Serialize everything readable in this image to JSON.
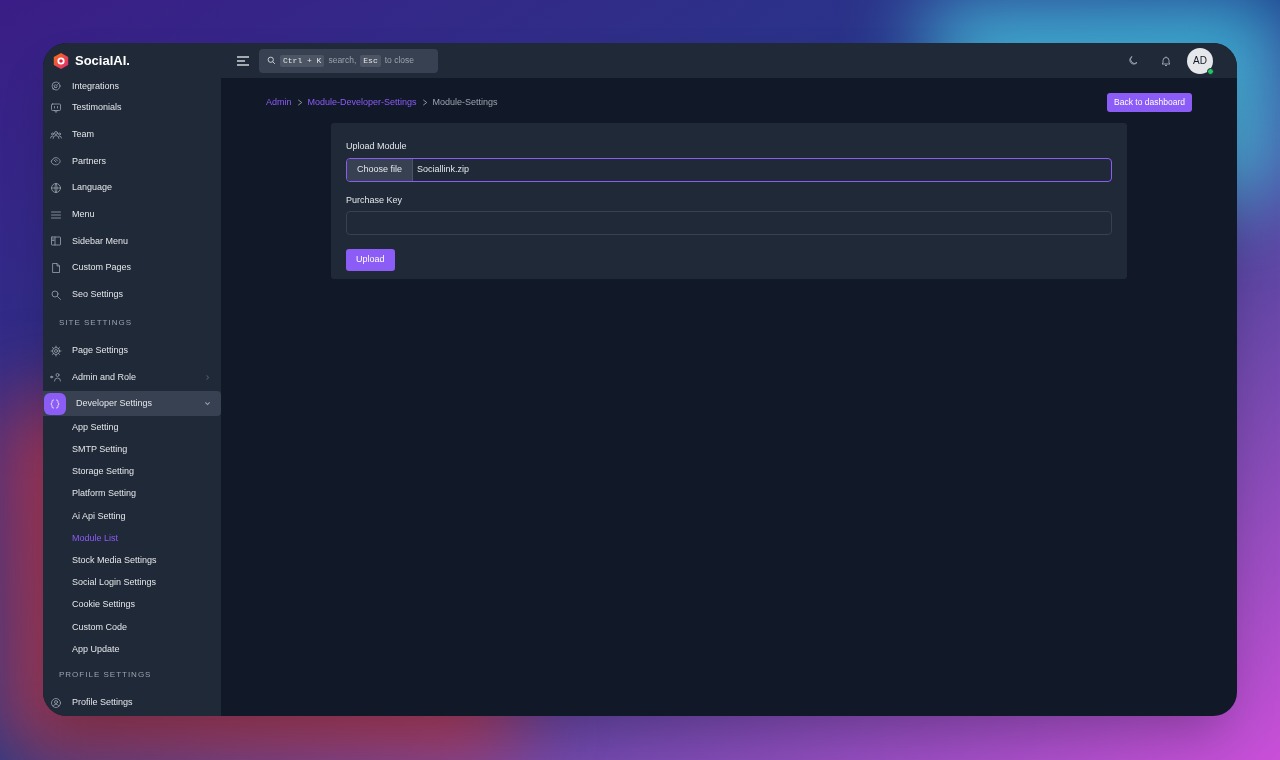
{
  "app": {
    "name": "SocialAI."
  },
  "search": {
    "shortcut_key": "Ctrl + K",
    "shortcut_text": "search,",
    "close_key": "Esc",
    "close_text": "to close"
  },
  "user": {
    "initials": "AD",
    "online": true
  },
  "sidebar": {
    "items": [
      {
        "kind": "link",
        "label": "Integrations",
        "selected": false
      },
      {
        "kind": "link",
        "label": "Testimonials",
        "selected": false
      },
      {
        "kind": "link",
        "label": "Team",
        "selected": false
      },
      {
        "kind": "link",
        "label": "Partners",
        "selected": false
      },
      {
        "kind": "link",
        "label": "Language",
        "selected": false
      },
      {
        "kind": "link",
        "label": "Menu",
        "selected": false
      },
      {
        "kind": "link",
        "label": "Sidebar Menu",
        "selected": false
      },
      {
        "kind": "link",
        "label": "Custom Pages",
        "selected": false
      },
      {
        "kind": "link",
        "label": "Seo Settings",
        "selected": false
      },
      {
        "kind": "heading",
        "label": "SITE SETTINGS"
      },
      {
        "kind": "link",
        "label": "Page Settings",
        "selected": false
      },
      {
        "kind": "group",
        "label": "Admin and Role",
        "selected": false,
        "expanded": false
      },
      {
        "kind": "group",
        "label": "Developer Settings",
        "selected": true,
        "expanded": true,
        "children": [
          {
            "label": "App Setting",
            "selected": false
          },
          {
            "label": "SMTP Setting",
            "selected": false
          },
          {
            "label": "Storage Setting",
            "selected": false
          },
          {
            "label": "Platform Setting",
            "selected": false
          },
          {
            "label": "Ai Api Setting",
            "selected": false
          },
          {
            "label": "Module List",
            "selected": true
          },
          {
            "label": "Stock Media Settings",
            "selected": false
          },
          {
            "label": "Social Login Settings",
            "selected": false
          },
          {
            "label": "Cookie Settings",
            "selected": false
          },
          {
            "label": "Custom Code",
            "selected": false
          },
          {
            "label": "App Update",
            "selected": false
          }
        ]
      },
      {
        "kind": "heading",
        "label": "PROFILE SETTINGS"
      },
      {
        "kind": "link",
        "label": "Profile Settings",
        "selected": false
      }
    ]
  },
  "breadcrumb": [
    {
      "label": "Admin",
      "link": true
    },
    {
      "label": "Module-Developer-Settings",
      "link": true
    },
    {
      "label": "Module-Settings",
      "link": false
    }
  ],
  "back_button": "Back to dashboard",
  "form": {
    "upload_label": "Upload Module",
    "choose_button": "Choose file",
    "file_name": "Sociallink.zip",
    "upload_focused": true,
    "key_label": "Purchase Key",
    "submit": "Upload"
  }
}
